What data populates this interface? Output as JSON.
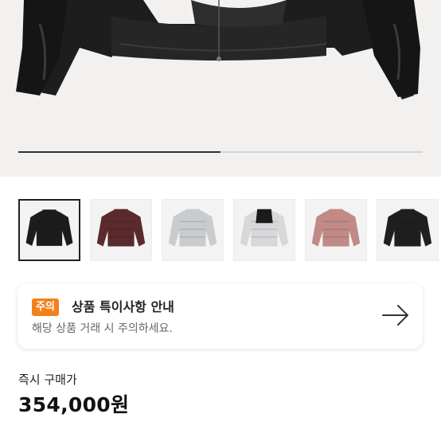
{
  "hero": {
    "image": "black-puffer-jacket-cropped",
    "slide_progress": 0.5
  },
  "thumbnails": [
    {
      "name": "black-shiny-puffer",
      "color": "#1c1c1c",
      "accent": "#1c1c1c",
      "selected": true
    },
    {
      "name": "burgundy-puffer",
      "color": "#5a2a2c",
      "accent": "#5a2a2c",
      "selected": false
    },
    {
      "name": "light-gray-puffer",
      "color": "#c9ccce",
      "accent": "#c9ccce",
      "selected": false
    },
    {
      "name": "silver-black-puffer",
      "color": "#d7d8d9",
      "accent": "#1b1b1b",
      "selected": false
    },
    {
      "name": "dusty-pink-puffer",
      "color": "#c08a86",
      "accent": "#c08a86",
      "selected": false
    },
    {
      "name": "black-matte-puffer",
      "color": "#1f1f1f",
      "accent": "#1f1f1f",
      "selected": false
    }
  ],
  "notice": {
    "badge": "주의",
    "title": "상품 특이사항 안내",
    "subtitle": "해당 상품 거래 시 주의하세요.",
    "badge_color": "#f2811a",
    "icon": "arrow-right-icon"
  },
  "price": {
    "label": "즉시 구매가",
    "value": "354,000원"
  }
}
